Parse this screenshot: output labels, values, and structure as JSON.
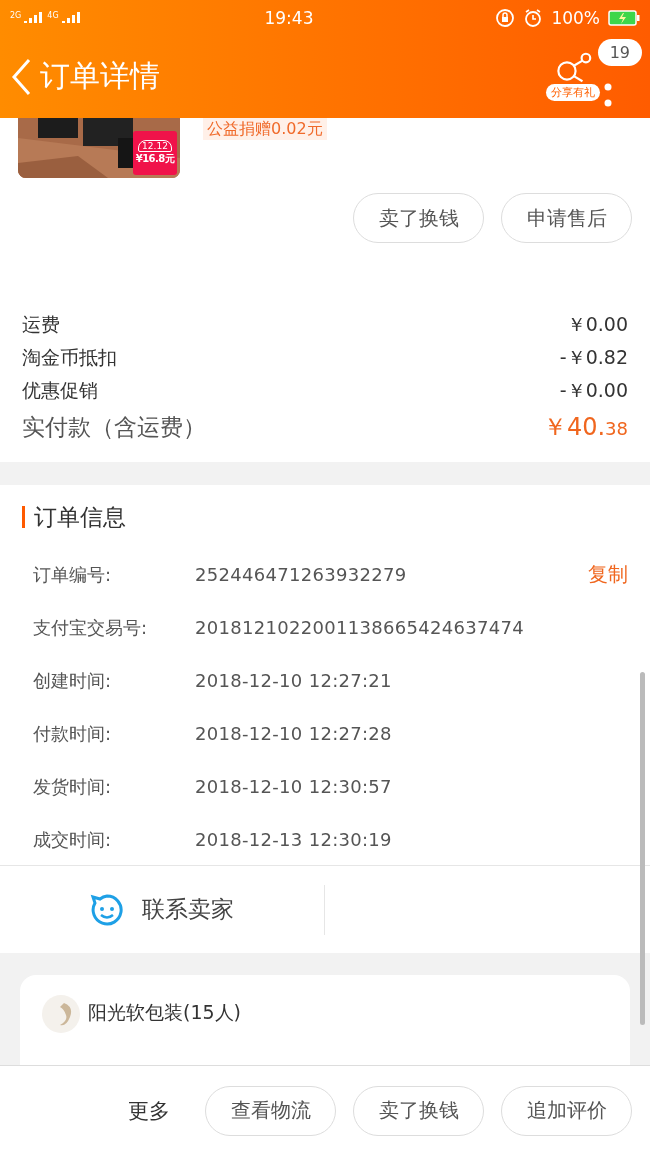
{
  "status_bar": {
    "network_1": "2G",
    "network_2": "4G",
    "time": "19:43",
    "battery": "100%"
  },
  "nav": {
    "title": "订单详情",
    "share_label": "分享有礼",
    "message_count": "19"
  },
  "product": {
    "badge_logo": "12.12",
    "badge_price": "¥16.8元",
    "donation": "公益捐赠0.02元"
  },
  "item_actions": [
    "卖了换钱",
    "申请售后"
  ],
  "fees": [
    {
      "label": "运费",
      "value": "￥0.00"
    },
    {
      "label": "淘金币抵扣",
      "value": "-￥0.82"
    },
    {
      "label": "优惠促销",
      "value": "-￥0.00"
    }
  ],
  "total": {
    "label": "实付款（含运费）",
    "currency": "￥",
    "integer": "40.",
    "decimal": "38"
  },
  "order_info": {
    "title": "订单信息",
    "copy_label": "复制",
    "rows": [
      {
        "label": "订单编号:",
        "value": "252446471263932279"
      },
      {
        "label": "支付宝交易号:",
        "value": "2018121022001138665424637474"
      },
      {
        "label": "创建时间:",
        "value": "2018-12-10 12:27:21"
      },
      {
        "label": "付款时间:",
        "value": "2018-12-10 12:27:28"
      },
      {
        "label": "发货时间:",
        "value": "2018-12-10 12:30:57"
      },
      {
        "label": "成交时间:",
        "value": "2018-12-13 12:30:19"
      }
    ]
  },
  "contact": {
    "label": "联系卖家"
  },
  "group": {
    "name": "阳光软包装(15人)"
  },
  "bottom_bar": {
    "more": "更多",
    "buttons": [
      "查看物流",
      "卖了换钱",
      "追加评价"
    ]
  }
}
